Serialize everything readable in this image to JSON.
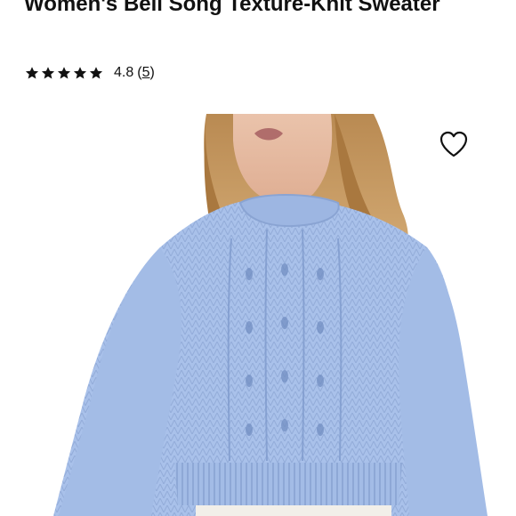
{
  "product": {
    "title": "Women's Bell Song Texture-Knit Sweater",
    "rating_value": "4.8",
    "review_count": "5",
    "open_paren": "(",
    "close_paren": ")",
    "stars_filled": 5,
    "stars_total": 5
  },
  "icons": {
    "star": "star-icon",
    "favorite": "heart-outline-icon"
  },
  "colors": {
    "text": "#111111",
    "sweater": "#a9c1ea",
    "background": "#ffffff"
  }
}
